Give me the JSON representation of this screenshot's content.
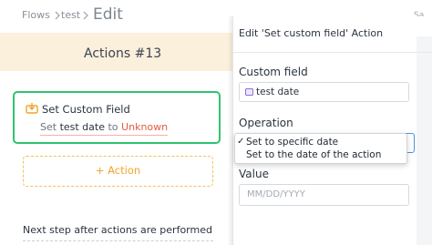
{
  "breadcrumb": {
    "flows": "Flows",
    "test": "test",
    "title": "Edit",
    "save": "Sa"
  },
  "band": {
    "title": "Actions #13"
  },
  "card": {
    "title": "Set Custom Field",
    "desc_prefix": "Set ",
    "desc_field": "test date",
    "desc_mid": " to ",
    "desc_value": "Unknown"
  },
  "add_action": "+ Action",
  "next_step": "Next step after actions are performed",
  "panel": {
    "title": "Edit 'Set custom field' Action",
    "custom_field_label": "Custom field",
    "custom_field_value": "test date",
    "operation_label": "Operation",
    "operation_options": [
      "Set to specific date",
      "Set to the date of the action"
    ],
    "selected_check": "✓",
    "value_label": "Value",
    "value_placeholder": "MM/DD/YYYY"
  },
  "colors": {
    "success": "#2fc36e",
    "accent": "#f0a52a",
    "warning": "#e25b45",
    "band": "#fbf0dc"
  }
}
